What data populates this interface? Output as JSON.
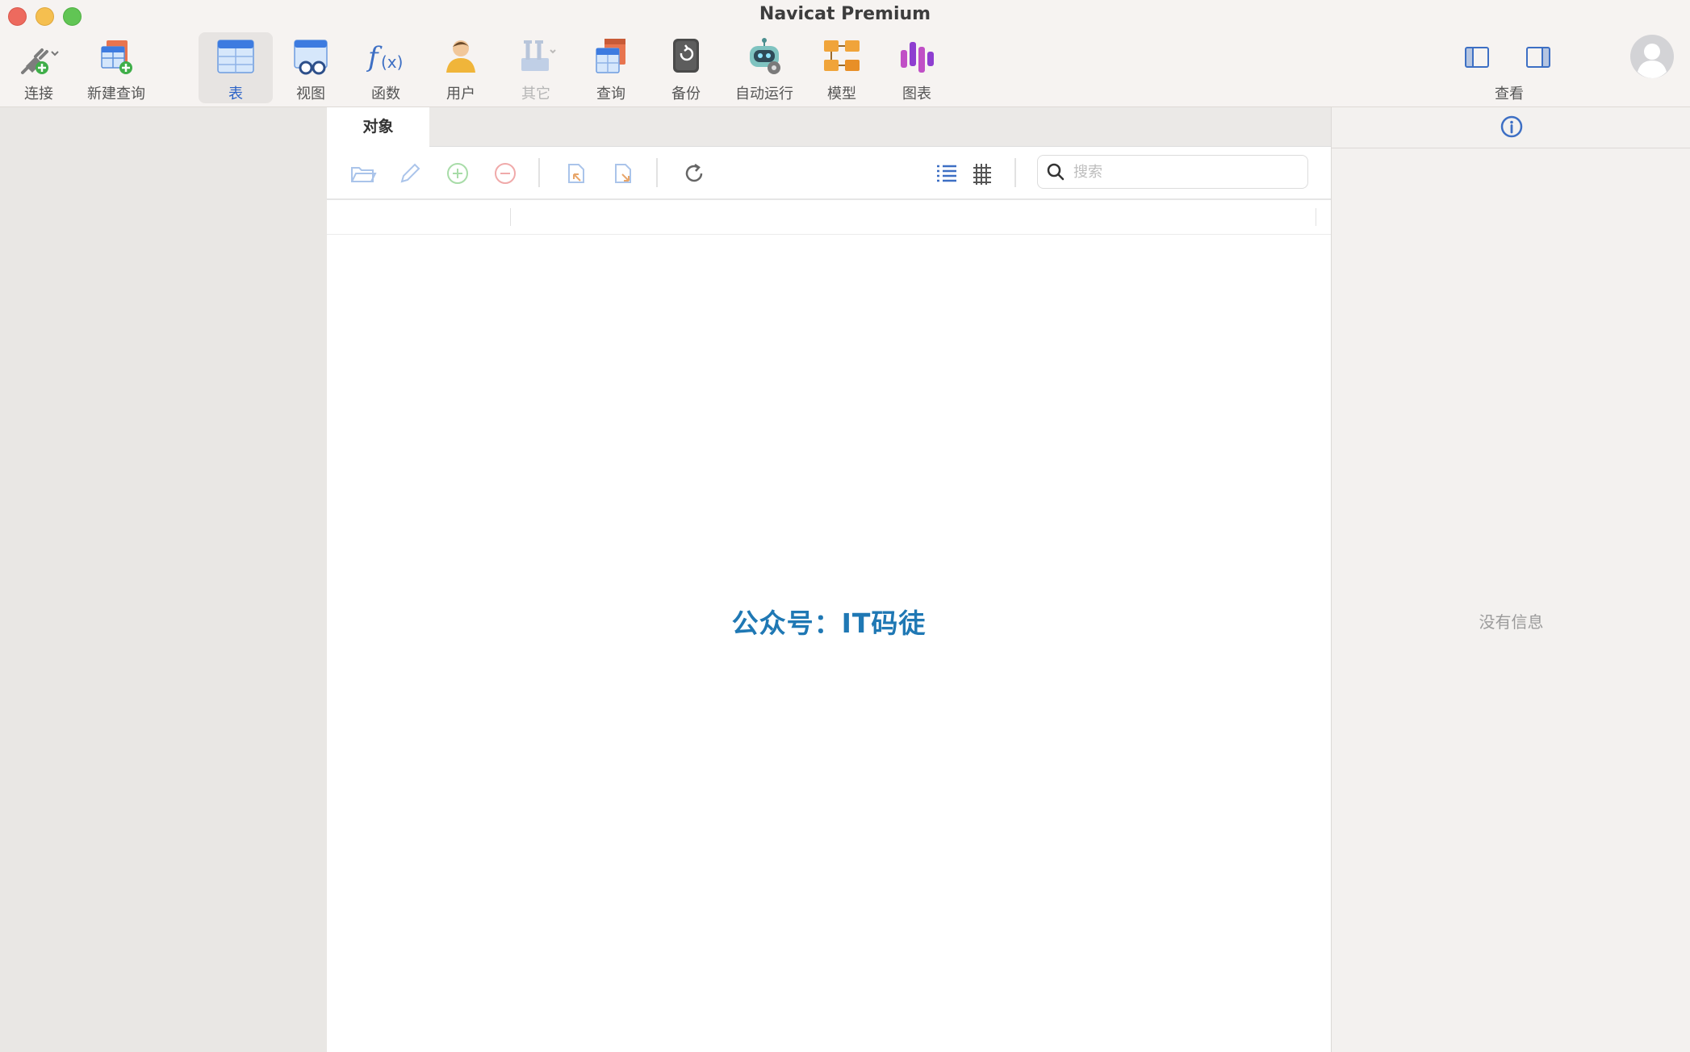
{
  "window": {
    "title": "Navicat Premium"
  },
  "toolbar": {
    "items": [
      {
        "id": "connect",
        "label": "连接",
        "icon": "plug-add-icon"
      },
      {
        "id": "new-query",
        "label": "新建查询",
        "icon": "table-add-icon"
      },
      {
        "id": "table",
        "label": "表",
        "icon": "table-icon",
        "active": true
      },
      {
        "id": "view",
        "label": "视图",
        "icon": "glasses-table-icon"
      },
      {
        "id": "function",
        "label": "函数",
        "icon": "fx-icon"
      },
      {
        "id": "user",
        "label": "用户",
        "icon": "user-icon"
      },
      {
        "id": "other",
        "label": "其它",
        "icon": "tools-icon",
        "disabled": true
      },
      {
        "id": "query",
        "label": "查询",
        "icon": "query-icon"
      },
      {
        "id": "backup",
        "label": "备份",
        "icon": "backup-icon"
      },
      {
        "id": "automation",
        "label": "自动运行",
        "icon": "robot-icon"
      },
      {
        "id": "model",
        "label": "模型",
        "icon": "model-icon"
      },
      {
        "id": "chart",
        "label": "图表",
        "icon": "chart-icon"
      }
    ],
    "view_label": "查看"
  },
  "tabs": [
    {
      "label": "对象"
    }
  ],
  "object_toolbar": {
    "search_placeholder": "搜索"
  },
  "watermark": "公众号：IT码徒",
  "info_panel": {
    "empty_text": "没有信息"
  },
  "colors": {
    "accent": "#2b63c7",
    "watermark": "#1f78b4"
  }
}
